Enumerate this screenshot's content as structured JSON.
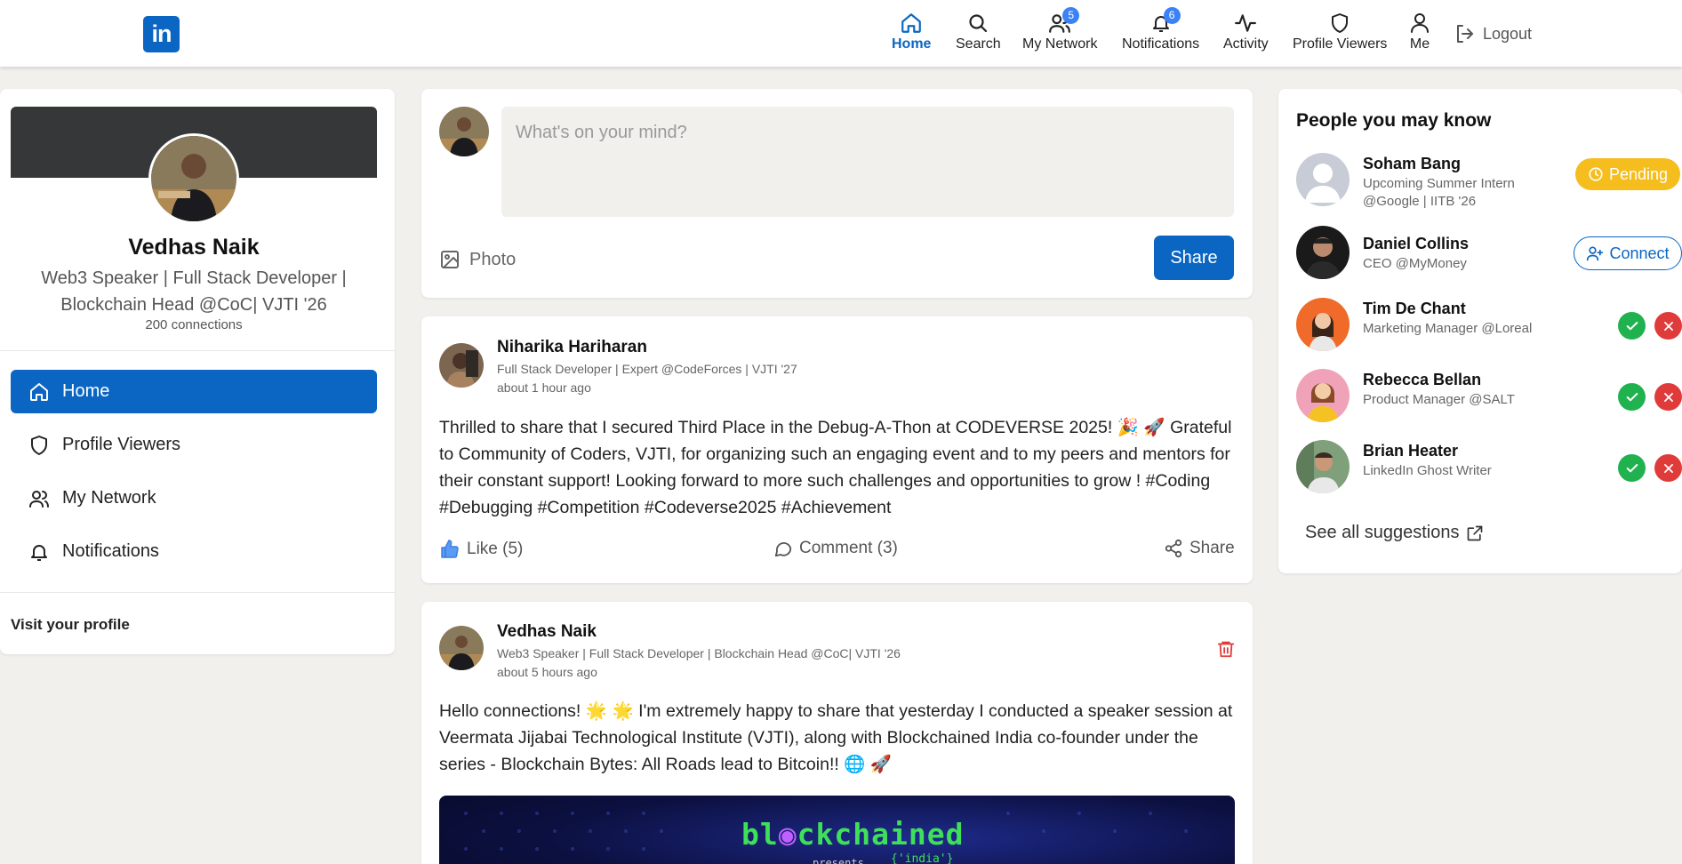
{
  "nav": {
    "logo_text": "in",
    "items": [
      {
        "label": "Home",
        "icon": "home-icon"
      },
      {
        "label": "Search",
        "icon": "search-icon"
      },
      {
        "label": "My Network",
        "icon": "users-icon",
        "badge": "5"
      },
      {
        "label": "Notifications",
        "icon": "bell-icon",
        "badge": "6"
      },
      {
        "label": "Activity",
        "icon": "activity-icon"
      },
      {
        "label": "Profile Viewers",
        "icon": "shield-icon"
      },
      {
        "label": "Me",
        "icon": "user-icon"
      }
    ],
    "logout": "Logout"
  },
  "profile": {
    "name": "Vedhas Naik",
    "title": "Web3 Speaker | Full Stack Developer | Blockchain Head @CoC| VJTI '26",
    "connections": "200 connections",
    "menu": [
      {
        "label": "Home",
        "icon": "home-icon"
      },
      {
        "label": "Profile Viewers",
        "icon": "shield-icon"
      },
      {
        "label": "My Network",
        "icon": "users-icon"
      },
      {
        "label": "Notifications",
        "icon": "bell-icon"
      }
    ],
    "visit": "Visit your profile"
  },
  "composer": {
    "placeholder": "What's on your mind?",
    "photo_label": "Photo",
    "share_label": "Share"
  },
  "posts": [
    {
      "author": "Niharika Hariharan",
      "headline": "Full Stack Developer | Expert @CodeForces | VJTI '27",
      "time": "about 1 hour ago",
      "body": "Thrilled to share that I secured Third Place in the Debug-A-Thon at CODEVERSE 2025! 🎉 🚀 Grateful to Community of Coders, VJTI, for organizing such an engaging event and to my peers and mentors for their constant support! Looking forward to more such challenges and opportunities to grow ! #Coding #Debugging #Competition #Codeverse2025 #Achievement",
      "like": "Like (5)",
      "comment": "Comment (3)",
      "share": "Share"
    },
    {
      "author": "Vedhas Naik",
      "headline": "Web3 Speaker | Full Stack Developer | Blockchain Head @CoC| VJTI '26",
      "time": "about 5 hours ago",
      "body": "Hello connections! 🌟 🌟 I'm extremely happy to share that yesterday I conducted a speaker session at Veermata Jijabai Technological Institute (VJTI), along with Blockchained India co-founder under the series - Blockchain Bytes: All Roads lead to Bitcoin!! 🌐 🚀",
      "image": {
        "word1": "bl",
        "word2": "ckchained",
        "sub": "{'india'}",
        "presents": "presents"
      }
    }
  ],
  "suggestions": {
    "heading": "People you may know",
    "people": [
      {
        "name": "Soham Bang",
        "sub": "Upcoming Summer Intern @Google | IITB '26",
        "action": "Pending"
      },
      {
        "name": "Daniel Collins",
        "sub": "CEO @MyMoney",
        "action": "Connect"
      },
      {
        "name": "Tim De Chant",
        "sub": "Marketing Manager @Loreal"
      },
      {
        "name": "Rebecca Bellan",
        "sub": "Product Manager @SALT"
      },
      {
        "name": "Brian Heater",
        "sub": "LinkedIn Ghost Writer"
      }
    ],
    "see_all": "See all suggestions"
  },
  "colors": {
    "brand": "#0a66c2",
    "pending": "#f5bd1e",
    "accept": "#20b24e",
    "reject": "#e03b3b",
    "background": "#f1f0ec"
  }
}
